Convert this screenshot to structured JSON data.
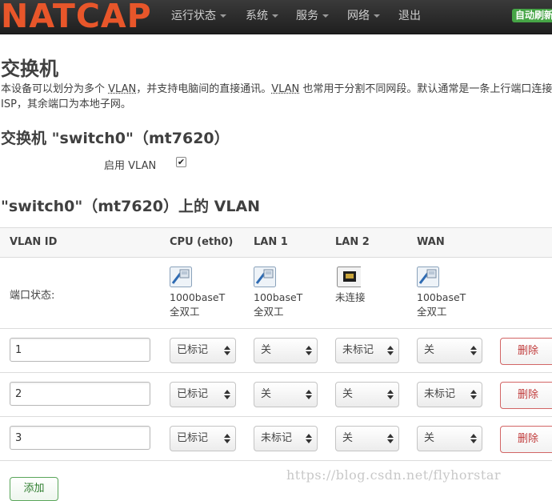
{
  "brand": "NATCAP",
  "nav": {
    "items": [
      {
        "label": "运行状态",
        "dropdown": true
      },
      {
        "label": "系统",
        "dropdown": true
      },
      {
        "label": "服务",
        "dropdown": true
      },
      {
        "label": "网络",
        "dropdown": true
      },
      {
        "label": "退出",
        "dropdown": false
      }
    ],
    "auto_refresh": "自动刷新"
  },
  "page": {
    "title": "交换机",
    "description_parts": [
      "本设备可以划分为多个 ",
      "VLAN",
      "，并支持电脑间的直接通讯。",
      "VLAN",
      " 也常用于分割不同网段。默认通常是一条上行端口连接 ISP，其余端口为本地子网。"
    ]
  },
  "switch": {
    "heading": "交换机 \"switch0\"（mt7620）",
    "enable_vlan_label": "启用 VLAN",
    "enable_vlan_checked": true
  },
  "vlan_section": {
    "heading": "\"switch0\"（mt7620）上的 VLAN",
    "columns": [
      "VLAN ID",
      "CPU (eth0)",
      "LAN 1",
      "LAN 2",
      "WAN"
    ],
    "port_status_label": "端口状态:",
    "ports": [
      {
        "icon": "ethernet-port-connected-icon",
        "speed": "1000baseT",
        "duplex": "全双工",
        "connected": true
      },
      {
        "icon": "ethernet-port-connected-icon",
        "speed": "100baseT",
        "duplex": "全双工",
        "connected": true
      },
      {
        "icon": "ethernet-port-disconnected-icon",
        "speed": "未连接",
        "duplex": "",
        "connected": false
      },
      {
        "icon": "ethernet-port-connected-icon",
        "speed": "100baseT",
        "duplex": "全双工",
        "connected": true
      }
    ],
    "rows": [
      {
        "vid": "1",
        "cpu": "已标记",
        "lan1": "关",
        "lan2": "未标记",
        "wan": "关",
        "delete": "删除"
      },
      {
        "vid": "2",
        "cpu": "已标记",
        "lan1": "关",
        "lan2": "关",
        "wan": "未标记",
        "delete": "删除"
      },
      {
        "vid": "3",
        "cpu": "已标记",
        "lan1": "未标记",
        "lan2": "关",
        "wan": "关",
        "delete": "删除"
      }
    ],
    "add_label": "添加"
  },
  "watermark": "https://blog.csdn.net/flyhorstar",
  "colors": {
    "brand": "#e8562a",
    "navbar": "#2b2b2b",
    "auto_refresh_bg": "#46a546",
    "delete": "#c03a3a",
    "add": "#2f7d2f"
  }
}
